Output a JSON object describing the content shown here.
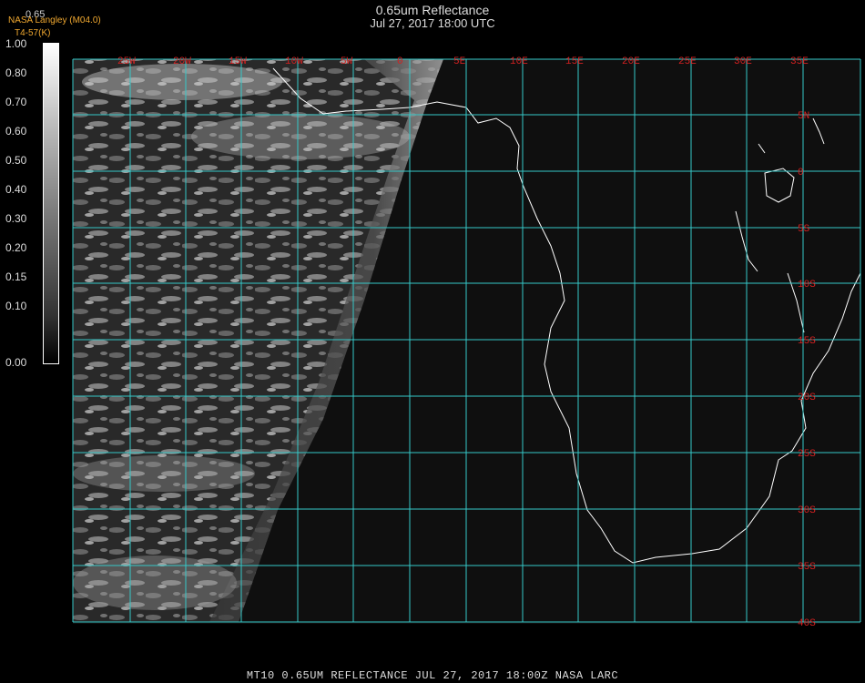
{
  "header": {
    "title": "0.65um Reflectance",
    "subtitle": "Jul 27, 2017 18:00 UTC",
    "credit_line1": "NASA Langley (M04.0)",
    "credit_line2": "T4-57(K)",
    "colorbar_top": "0.65"
  },
  "colorbar": {
    "labels": [
      "1.00",
      "0.80",
      "0.70",
      "0.60",
      "0.50",
      "0.40",
      "0.30",
      "0.20",
      "0.15",
      "0.10",
      "0.00"
    ]
  },
  "map": {
    "lon_labels": [
      "25W",
      "20W",
      "15W",
      "10W",
      "5W",
      "0",
      "5E",
      "10E",
      "15E",
      "20E",
      "25E",
      "30E",
      "35E"
    ],
    "lat_labels": [
      "5N",
      "0",
      "5S",
      "10S",
      "15S",
      "20S",
      "25S",
      "30S",
      "35S",
      "40S"
    ],
    "grid_color": "#35c8c8",
    "label_color": "#d42020",
    "lon_range": [
      -30,
      35
    ],
    "lat_range": [
      -40,
      10
    ]
  },
  "footer": "MT10  0.65UM REFLECTANCE   JUL 27, 2017 18:00Z   NASA LARC"
}
